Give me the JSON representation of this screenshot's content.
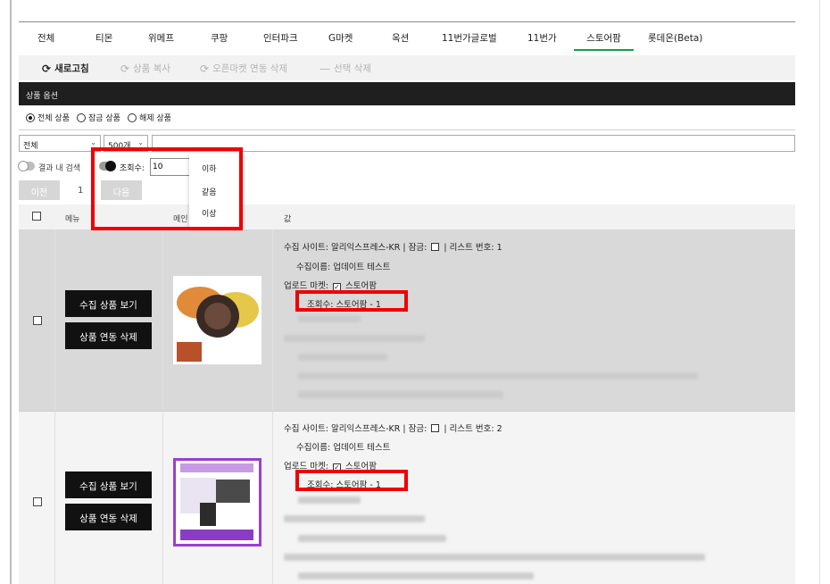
{
  "tabs": [
    {
      "label": "전체"
    },
    {
      "label": "티몬"
    },
    {
      "label": "위메프"
    },
    {
      "label": "쿠팡"
    },
    {
      "label": "인터파크"
    },
    {
      "label": "G마켓"
    },
    {
      "label": "옥션"
    },
    {
      "label": "11번가글로벌"
    },
    {
      "label": "11번가"
    },
    {
      "label": "스토어팜",
      "active": true
    },
    {
      "label": "롯데온(Beta)"
    }
  ],
  "toolbar": {
    "refresh": "새로고침",
    "copy": "상품 복사",
    "delete_link": "오픈마켓 연동 삭제",
    "delete_selected": "선택 삭제"
  },
  "options": {
    "title": "상품 옵션",
    "radios": [
      "전체 상품",
      "잠금 상품",
      "해제 상품"
    ],
    "selected_radio": 0
  },
  "filters": {
    "scope": "전체",
    "page_size": "500개",
    "search_in_results": "결과 내 검색",
    "views_label": "조회수:",
    "views_value": "10"
  },
  "dropdown": {
    "items": [
      "이하",
      "같음",
      "이상"
    ]
  },
  "pager": {
    "prev": "이전",
    "page": "1",
    "next": "다음"
  },
  "table": {
    "headers": [
      "메뉴",
      "메인",
      "값"
    ]
  },
  "rows": [
    {
      "view_button": "수집 상품 보기",
      "delete_button": "상품 연동 삭제",
      "site_label": "수집 사이트:",
      "site_value": "알리익스프레스-KR",
      "lock_label": "잠금:",
      "list_label": "리스트 번호:",
      "list_no": "1",
      "name_label": "수집이름:",
      "name_value": "업데이트 테스트",
      "market_label": "업로드 마켓:",
      "market_value": "스토어팜",
      "views_text": "조회수: 스토어팜 - 1"
    },
    {
      "view_button": "수집 상품 보기",
      "delete_button": "상품 연동 삭제",
      "site_label": "수집 사이트:",
      "site_value": "알리익스프레스-KR",
      "lock_label": "잠금:",
      "list_label": "리스트 번호:",
      "list_no": "2",
      "name_label": "수집이름:",
      "name_value": "업데이트 테스트",
      "market_label": "업로드 마켓:",
      "market_value": "스토어팜",
      "views_text": "조회수: 스토어팜 - 1"
    }
  ],
  "colors": {
    "highlight": "#ee0000",
    "active_tab": "#1a9c4a",
    "header_bar": "#1f1f1f",
    "row_selected_bg": "#d9d9d9"
  }
}
